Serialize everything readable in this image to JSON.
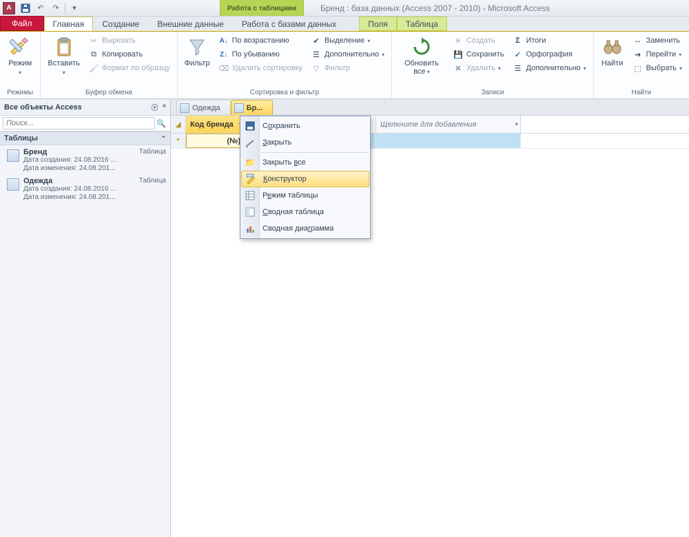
{
  "title": "Бренд : база данных (Access 2007 - 2010)  -  Microsoft Access",
  "context_header": "Работа с таблицами",
  "app_letter": "A",
  "tabs": {
    "file": "Файл",
    "home": "Главная",
    "create": "Создание",
    "external": "Внешние данные",
    "dbtools": "Работа с базами данных",
    "ctx_fields": "Поля",
    "ctx_table": "Таблица"
  },
  "ribbon": {
    "modes": {
      "label": "Режимы",
      "mode_btn": "Режим"
    },
    "clipboard": {
      "label": "Буфер обмена",
      "paste": "Вставить",
      "cut": "Вырезать",
      "copy": "Копировать",
      "fmtpaint": "Формат по образцу"
    },
    "sortfilter": {
      "label": "Сортировка и фильтр",
      "filter": "Фильтр",
      "asc": "По возрастанию",
      "desc": "По убыванию",
      "clear_sort": "Удалить сортировку",
      "selection": "Выделение",
      "advanced": "Дополнительно",
      "toggle_filter": "Фильтр"
    },
    "records": {
      "label": "Записи",
      "refresh": "Обновить все",
      "new": "Создать",
      "save": "Сохранить",
      "delete": "Удалить",
      "totals": "Итоги",
      "spelling": "Орфография",
      "more": "Дополнительно"
    },
    "find": {
      "label": "Найти",
      "find": "Найти",
      "replace": "Заменить",
      "goto": "Перейти",
      "select": "Выбрать"
    }
  },
  "nav": {
    "header": "Все объекты Access",
    "search_placeholder": "Поиск...",
    "cat_tables": "Таблицы",
    "items": [
      {
        "name": "Бренд",
        "type": "Таблица",
        "created": "Дата создания: 24.08.2016 ...",
        "modified": "Дата изменения: 24.08.201..."
      },
      {
        "name": "Одежда",
        "type": "Таблица",
        "created": "Дата создания: 24.08.2016 ...",
        "modified": "Дата изменения: 24.08.201..."
      }
    ]
  },
  "datasheet": {
    "tabs": [
      {
        "label": "Одежда",
        "active": false
      },
      {
        "label": "Бр...",
        "active": true
      }
    ],
    "col_selected": "Код бренда",
    "col_addnew": "Щелкните для добавления",
    "row_marker": "*",
    "cell_value": "(№)"
  },
  "ctxmenu": {
    "save": "Сохранить",
    "close": "Закрыть",
    "close_all": "Закрыть все",
    "design": "Конструктор",
    "datasheet": "Режим таблицы",
    "pivot_table": "Сводная таблица",
    "pivot_chart": "Сводная диаграмма"
  }
}
